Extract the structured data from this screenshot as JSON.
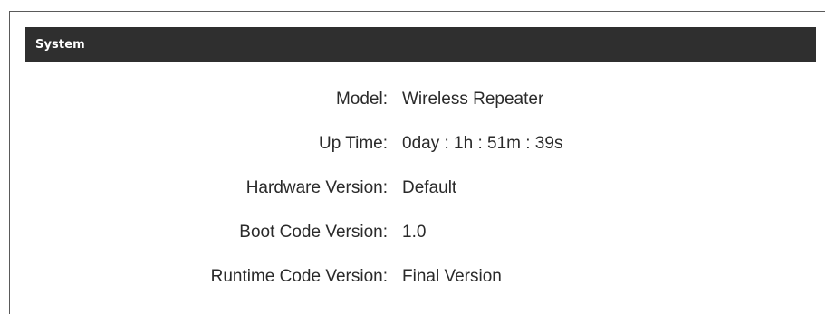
{
  "panel": {
    "title": "System"
  },
  "rows": [
    {
      "label": "Model:",
      "value": "Wireless Repeater"
    },
    {
      "label": "Up Time:",
      "value": "0day : 1h : 51m : 39s"
    },
    {
      "label": "Hardware Version:",
      "value": "Default"
    },
    {
      "label": "Boot Code Version:",
      "value": "1.0"
    },
    {
      "label": "Runtime Code Version:",
      "value": "Final Version"
    }
  ],
  "colors": {
    "header_bg": "#2f2f2f",
    "header_text": "#ffffff",
    "body_text": "#2a2a2a",
    "background": "#ffffff"
  }
}
